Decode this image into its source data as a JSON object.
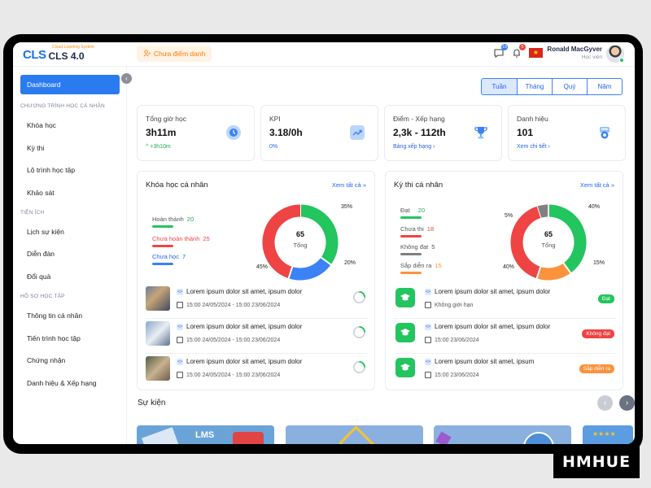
{
  "app": {
    "logo_abbr": "CLS",
    "logo_tagline": "Cloud Learning System",
    "logo_name": "CLS 4.0",
    "unscored_button": "Chưa điểm danh"
  },
  "header": {
    "chat_badge": "19",
    "notif_badge": "5",
    "user_name": "Ronald MacGyver",
    "user_role": "Học viên"
  },
  "sidebar": {
    "active": "Dashboard",
    "sections": [
      {
        "title": "CHƯƠNG TRÌNH HỌC CÁ NHÂN",
        "items": [
          "Khóa học",
          "Kỳ thi",
          "Lộ trình học tập",
          "Khảo sát"
        ]
      },
      {
        "title": "TIỆN ÍCH",
        "items": [
          "Lịch sự kiện",
          "Diễn đàn",
          "Đổi quà"
        ]
      },
      {
        "title": "HỒ SƠ HỌC TẬP",
        "items": [
          "Thông tin cá nhân",
          "Tiến trình học tập",
          "Chứng nhận",
          "Danh hiệu & Xếp hạng"
        ]
      }
    ]
  },
  "period_tabs": [
    "Tuần",
    "Tháng",
    "Quý",
    "Năm"
  ],
  "stats": [
    {
      "label": "Tổng giờ học",
      "value": "3h11m",
      "sub": "+3h10m",
      "sub_color": "#22a855",
      "icon": "clock-icon",
      "icon_bg": "#bcd6fb"
    },
    {
      "label": "KPI",
      "value": "3.18/0h",
      "sub": "0%",
      "sub_color": "#2563eb",
      "icon": "trend-icon",
      "icon_bg": "#bcd6fb"
    },
    {
      "label": "Điểm - Xếp hạng",
      "value": "2,3k - 112th",
      "sub": "Bảng xếp hạng",
      "sub_color": "#2563eb",
      "icon": "trophy-icon",
      "icon_bg": "#ffffff"
    },
    {
      "label": "Danh hiệu",
      "value": "101",
      "sub": "Xem chi tiết",
      "sub_color": "#2563eb",
      "icon": "medal-icon",
      "icon_bg": "#ffffff"
    }
  ],
  "courses": {
    "title": "Khóa học cá nhân",
    "see_all": "Xem tất cả",
    "legend": [
      {
        "label": "Hoàn thành",
        "value": "20",
        "color": "#22c55e"
      },
      {
        "label": "Chưa hoàn thành",
        "value": "25",
        "color": "#ef4444"
      },
      {
        "label": "Chưa học",
        "value": "7",
        "color": "#3b82f6"
      }
    ],
    "total": "65",
    "total_label": "Tổng",
    "slices": [
      {
        "label": "35%",
        "value": 35,
        "color": "#22c55e"
      },
      {
        "label": "20%",
        "value": 20,
        "color": "#3b82f6"
      },
      {
        "label": "45%",
        "value": 45,
        "color": "#ef4444"
      }
    ],
    "rows": [
      {
        "title": "Lorem ipsum dolor sit amet, ipsum dolor",
        "time": "15:00 24/05/2024 - 15:00 23/06/2024",
        "progress": 0.25
      },
      {
        "title": "Lorem ipsum dolor sit amet, ipsum dolor",
        "time": "15:00 24/05/2024 - 15:00 23/06/2024",
        "progress": 0.25
      },
      {
        "title": "Lorem ipsum dolor sit amet, ipsum dolor",
        "time": "15:00 24/05/2024 - 15:00 23/06/2024",
        "progress": 0.25
      }
    ]
  },
  "exams": {
    "title": "Kỳ thi cá nhân",
    "see_all": "Xem tất cả",
    "legend": [
      {
        "label": "Đạt",
        "value": "20",
        "color": "#22c55e"
      },
      {
        "label": "Chưa thi",
        "value": "18",
        "color": "#ef4444"
      },
      {
        "label": "Không đạt",
        "value": "5",
        "color": "#808080"
      },
      {
        "label": "Sắp diễn ra",
        "value": "15",
        "color": "#fb923c"
      }
    ],
    "total": "65",
    "total_label": "Tổng",
    "slices": [
      {
        "label": "5%",
        "value": 5,
        "color": "#808080"
      },
      {
        "label": "40%",
        "value": 40,
        "color": "#22c55e"
      },
      {
        "label": "15%",
        "value": 15,
        "color": "#fb923c"
      },
      {
        "label": "40%",
        "value": 40,
        "color": "#ef4444"
      }
    ],
    "rows": [
      {
        "title": "Lorem ipsum dolor sit amet, ipsum dolor",
        "time": "Không giới hạn",
        "status": "Đạt",
        "status_color": "#22c55e"
      },
      {
        "title": "Lorem ipsum dolor sit amet, ipsum dolor",
        "time": "15:00 23/06/2024",
        "status": "Không đạt",
        "status_color": "#ef4444"
      },
      {
        "title": "Lorem ipsum dolor sit amet, ipsum",
        "time": "15:00 23/06/2024",
        "status": "Sắp diễn ra",
        "status_color": "#fb923c"
      }
    ]
  },
  "events": {
    "title": "Sự kiện",
    "cards": [
      "LMS"
    ]
  },
  "watermark": "HMHUE"
}
